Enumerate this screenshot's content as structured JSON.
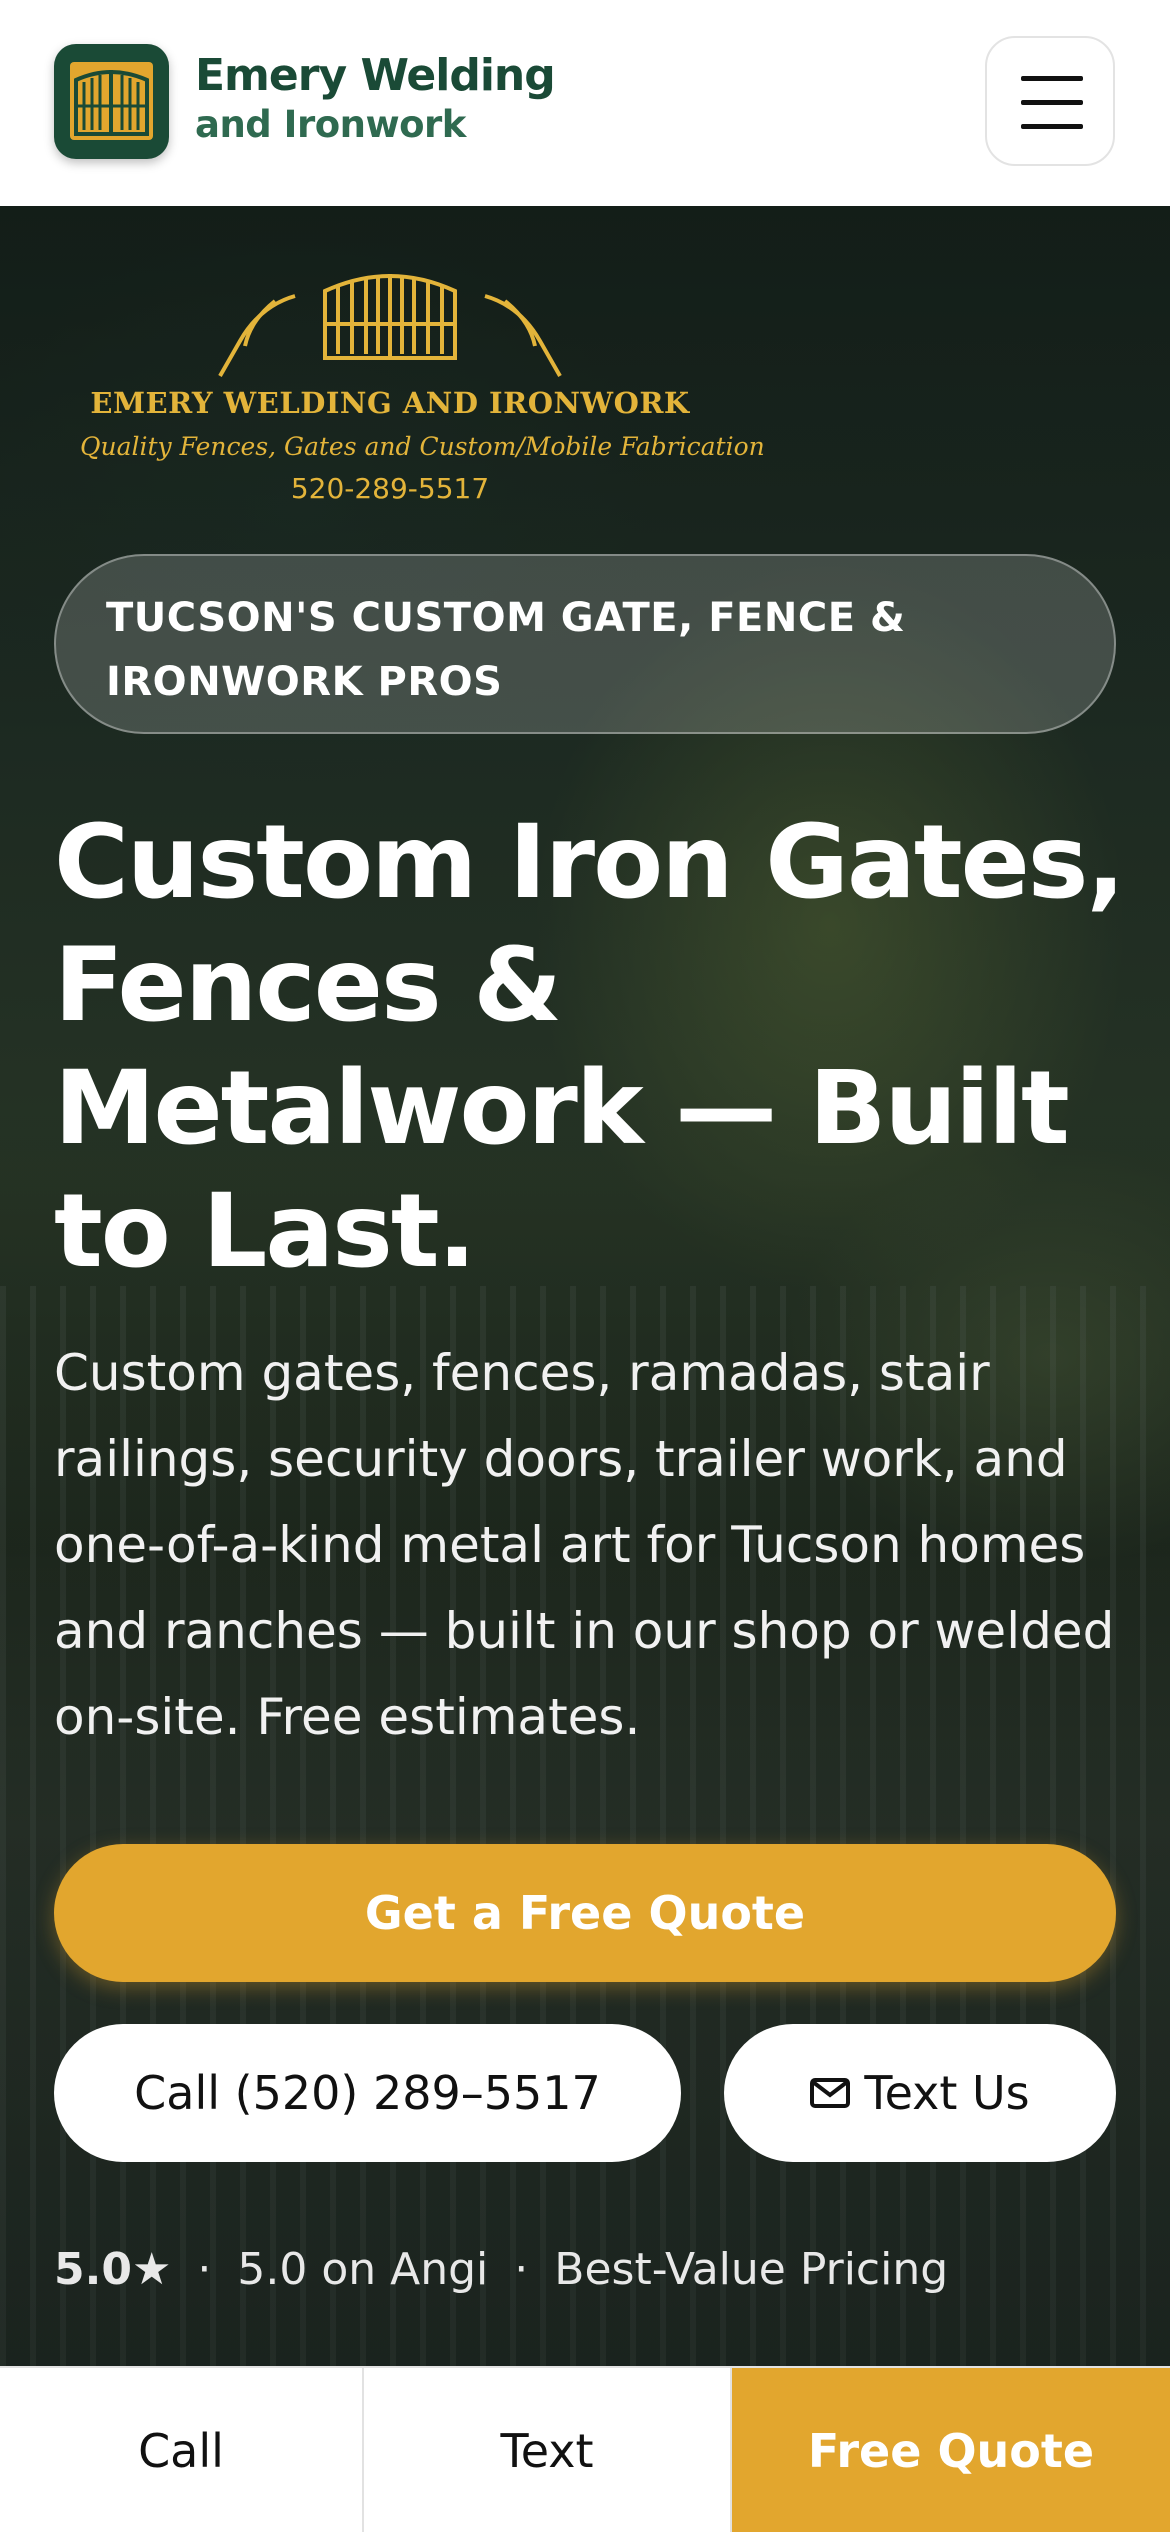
{
  "header": {
    "brand_name": "Emery Welding",
    "brand_sub": "and Ironwork",
    "menu_icon": "hamburger-menu-icon"
  },
  "hero": {
    "logo": {
      "title": "EMERY WELDING AND IRONWORK",
      "tagline": "Quality Fences, Gates and Custom/Mobile Fabrication",
      "phone": "520-289-5517"
    },
    "badge": "TUCSON'S CUSTOM GATE, FENCE & IRONWORK PROS",
    "headline": "Custom Iron Gates, Fences & Metalwork — Built to Last.",
    "description": "Custom gates, fences, ramadas, stair railings, security doors, trailer work, and one-of-a-kind metal art for Tucson homes and ranches — built in our shop or welded on-site. Free estimates.",
    "quote_button": "Get a Free Quote",
    "call_button": "Call (520) 289–5517",
    "text_button": "Text Us",
    "ratings": {
      "score": "5.0★",
      "separator": "·",
      "angi": "5.0 on Angi",
      "pricing": "Best-Value Pricing"
    }
  },
  "bottom_bar": {
    "call": "Call",
    "text": "Text",
    "quote": "Free Quote"
  },
  "colors": {
    "brand_green": "#1a4a36",
    "accent_gold": "#e2a62e",
    "logo_gold": "#e3b43a"
  }
}
